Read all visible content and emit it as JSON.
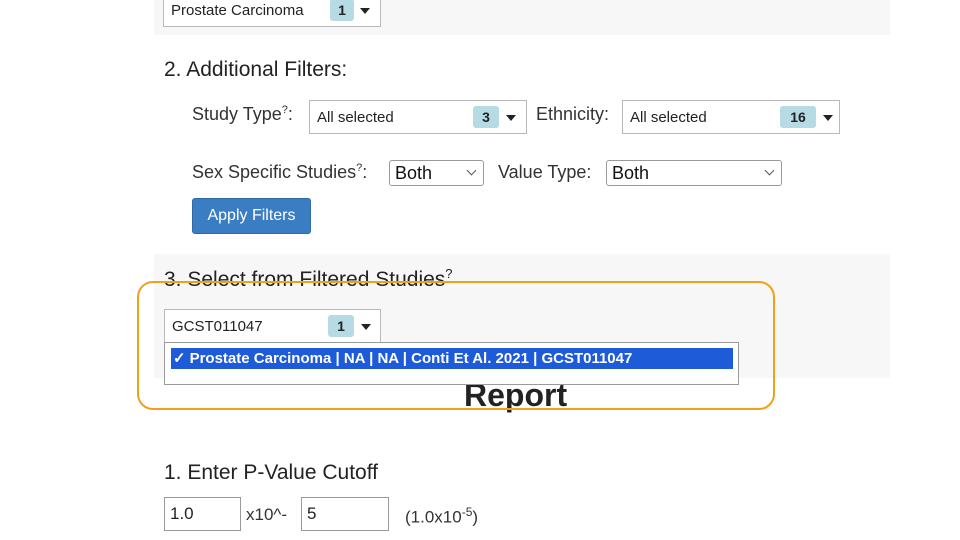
{
  "section1": {
    "dropdown_value": "Prostate Carcinoma",
    "dropdown_count": "1"
  },
  "section2": {
    "title": "2. Additional Filters:",
    "study_type_label": "Study Type",
    "study_type_sup": "?",
    "study_type_value": "All selected",
    "study_type_count": "3",
    "ethnicity_label": "Ethnicity:",
    "ethnicity_value": "All selected",
    "ethnicity_count": "16",
    "sex_label": "Sex Specific Studies",
    "sex_sup": "?",
    "sex_colon": ":",
    "sex_value": "Both",
    "value_type_label": "Value Type:",
    "value_type_value": "Both",
    "apply_button": "Apply Filters"
  },
  "section3": {
    "title": "3. Select from Filtered Studies",
    "title_sup": "?",
    "dropdown_value": "GCST011047",
    "dropdown_count": "1",
    "selected_option_check": "✓",
    "selected_option": "Prostate Carcinoma | NA | NA | Conti Et Al. 2021 | GCST011047"
  },
  "report": {
    "title": "Report",
    "pvalue_title": "1. Enter P-Value Cutoff",
    "mantissa": "1.0",
    "times_text": "x10^-",
    "exponent": "5",
    "preview_open": "(1.0x10",
    "preview_exp": "-5",
    "preview_close": ")"
  },
  "colors": {
    "highlight": "#f0a01c",
    "selected_option_bg": "#1d5bd8",
    "apply_button_bg": "#3a7dc2",
    "count_badge_bg": "#b7dbe4"
  }
}
